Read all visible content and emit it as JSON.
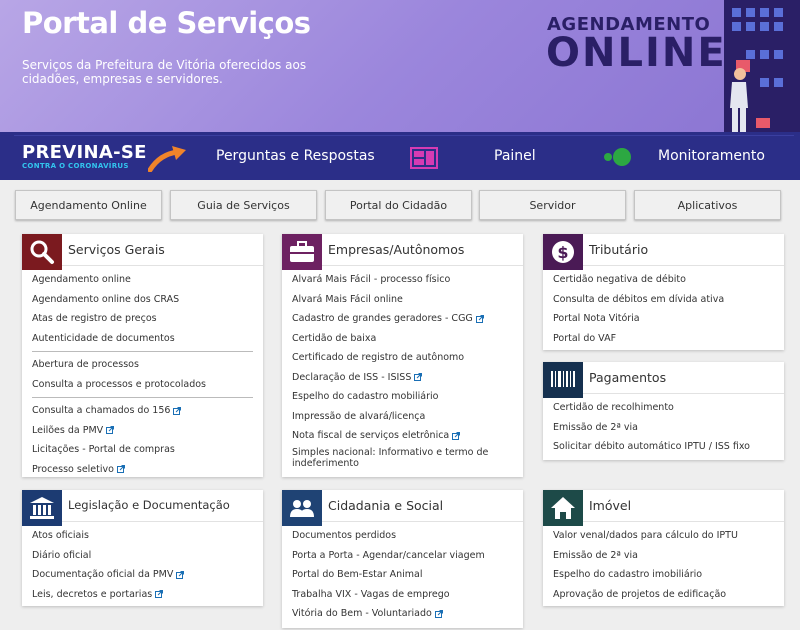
{
  "hero": {
    "title": "Portal de Serviços",
    "subtitle": "Serviços da Prefeitura de Vitória oferecidos aos cidadões, empresas e servidores.",
    "badge_line1": "AGENDAMENTO",
    "badge_line2": "ONLINE"
  },
  "strip": {
    "previna": "PREVINA-SE",
    "previna_sub": "CONTRA O CORONAVÍRUS",
    "links": [
      "Perguntas e Respostas",
      "Painel",
      "Monitoramento"
    ]
  },
  "buttons": [
    "Agendamento Online",
    "Guia de Serviços",
    "Portal do Cidadão",
    "Servidor",
    "Aplicativos"
  ],
  "cards": {
    "gerais": {
      "title": "Serviços Gerais",
      "items": [
        "Agendamento online",
        "Agendamento online dos CRAS",
        "Atas de registro de preços",
        "Autenticidade de documentos",
        "Abertura de processos",
        "Consulta a processos e protocolados",
        "Consulta a chamados do 156",
        "Leilões da PMV",
        "Licitações - Portal de compras",
        "Processo seletivo"
      ]
    },
    "empresas": {
      "title": "Empresas/Autônomos",
      "items": [
        "Alvará Mais Fácil - processo físico",
        "Alvará Mais Fácil online",
        "Cadastro de grandes geradores - CGG",
        "Certidão de baixa",
        "Certificado de registro de autônomo",
        "Declaração de ISS - ISISS",
        "Espelho do cadastro mobiliário",
        "Impressão de alvará/licença",
        "Nota fiscal de serviços eletrônica",
        "Simples nacional: Informativo e termo de indeferimento"
      ]
    },
    "tributario": {
      "title": "Tributário",
      "items": [
        "Certidão negativa de débito",
        "Consulta de débitos em dívida ativa",
        "Portal Nota Vitória",
        "Portal do VAF"
      ]
    },
    "pagamentos": {
      "title": "Pagamentos",
      "items": [
        "Certidão de recolhimento",
        "Emissão de 2ª via",
        "Solicitar débito automático IPTU / ISS fixo"
      ]
    },
    "legislacao": {
      "title": "Legislação e Documentação",
      "items": [
        "Atos oficiais",
        "Diário oficial",
        "Documentação oficial da PMV",
        "Leis, decretos e portarias"
      ]
    },
    "cidadania": {
      "title": "Cidadania e Social",
      "items": [
        "Documentos perdidos",
        "Porta a Porta - Agendar/cancelar viagem",
        "Portal do Bem-Estar Animal",
        "Trabalha VIX - Vagas de emprego",
        "Vitória do Bem - Voluntariado"
      ]
    },
    "imovel": {
      "title": "Imóvel",
      "items": [
        "Valor venal/dados para cálculo do IPTU",
        "Emissão de 2ª via",
        "Espelho do cadastro imobiliário",
        "Aprovação de projetos de edificação"
      ]
    }
  },
  "colors": {
    "gerais": "#7b1a1f",
    "empresas": "#6d2161",
    "tributario": "#4a1a55",
    "pagamentos": "#15304f",
    "legislacao": "#1c3b72",
    "cidadania": "#1f4374",
    "imovel": "#1d4a48"
  }
}
